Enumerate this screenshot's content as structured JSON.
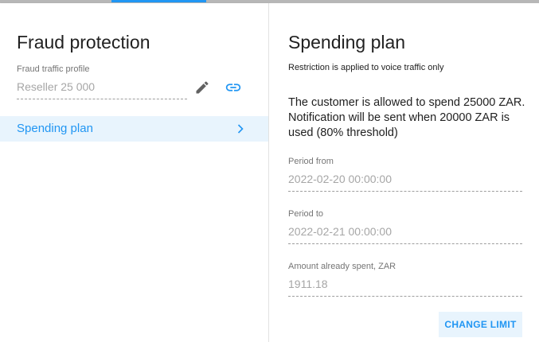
{
  "left": {
    "title": "Fraud protection",
    "fraud_profile": {
      "label": "Fraud traffic profile",
      "value": "Reseller 25 000"
    },
    "icons": {
      "edit": "pencil-icon",
      "link": "link-icon"
    },
    "menu": {
      "spending_plan_label": "Spending plan",
      "chevron_icon": "chevron-right-icon"
    }
  },
  "right": {
    "title": "Spending plan",
    "restriction_note": "Restriction is applied to voice traffic only",
    "description": "The customer is allowed to spend 25000 ZAR. Notification will be sent when 20000 ZAR is used (80% threshold)",
    "fields": {
      "period_from": {
        "label": "Period from",
        "value": "2022-02-20 00:00:00"
      },
      "period_to": {
        "label": "Period to",
        "value": "2022-02-21 00:00:00"
      },
      "amount_spent": {
        "label": "Amount already spent, ZAR",
        "value": "1911.18"
      }
    },
    "change_limit_label": "CHANGE LIMIT"
  },
  "colors": {
    "accent": "#2196f3",
    "selected_bg": "#e8f4fd",
    "text_primary": "#212121",
    "text_muted": "#757575",
    "value_disabled": "#a6a6a6",
    "icon_dark": "#616161"
  }
}
